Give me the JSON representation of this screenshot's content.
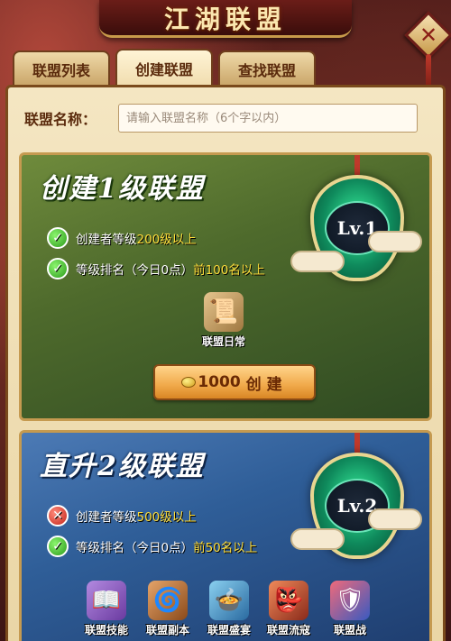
{
  "header": {
    "title": "江湖联盟",
    "close_symbol": "✕"
  },
  "tabs": [
    {
      "label": "联盟列表",
      "active": false
    },
    {
      "label": "创建联盟",
      "active": true
    },
    {
      "label": "查找联盟",
      "active": false
    }
  ],
  "name_field": {
    "label": "联盟名称：",
    "placeholder": "请输入联盟名称（6个字以内）"
  },
  "card1": {
    "title": "创建1级联盟",
    "badge": "Lv.1",
    "requirements": [
      {
        "status": "met",
        "prefix": "创建者等级",
        "highlight": "200级以上",
        "suffix": ""
      },
      {
        "status": "met",
        "prefix": "等级排名（今日0点）",
        "highlight": "前100名以上",
        "suffix": ""
      }
    ],
    "feature": {
      "label": "联盟日常"
    },
    "button": {
      "cost": "1000",
      "label": "创建"
    }
  },
  "card2": {
    "title": "直升2级联盟",
    "badge": "Lv.2",
    "requirements": [
      {
        "status": "unmet",
        "prefix": "创建者等级",
        "highlight": "500级以上",
        "suffix": ""
      },
      {
        "status": "met",
        "prefix": "等级排名（今日0点）",
        "highlight": "前50名以上",
        "suffix": ""
      }
    ],
    "features": [
      {
        "label": "联盟技能"
      },
      {
        "label": "联盟副本"
      },
      {
        "label": "联盟盛宴"
      },
      {
        "label": "联盟流寇"
      },
      {
        "label": "联盟战"
      }
    ]
  },
  "colors": {
    "accent": "#c79a4a",
    "highlight": "#ffde3b",
    "green_card": "#4e6a2c",
    "blue_card": "#2f5e98"
  }
}
